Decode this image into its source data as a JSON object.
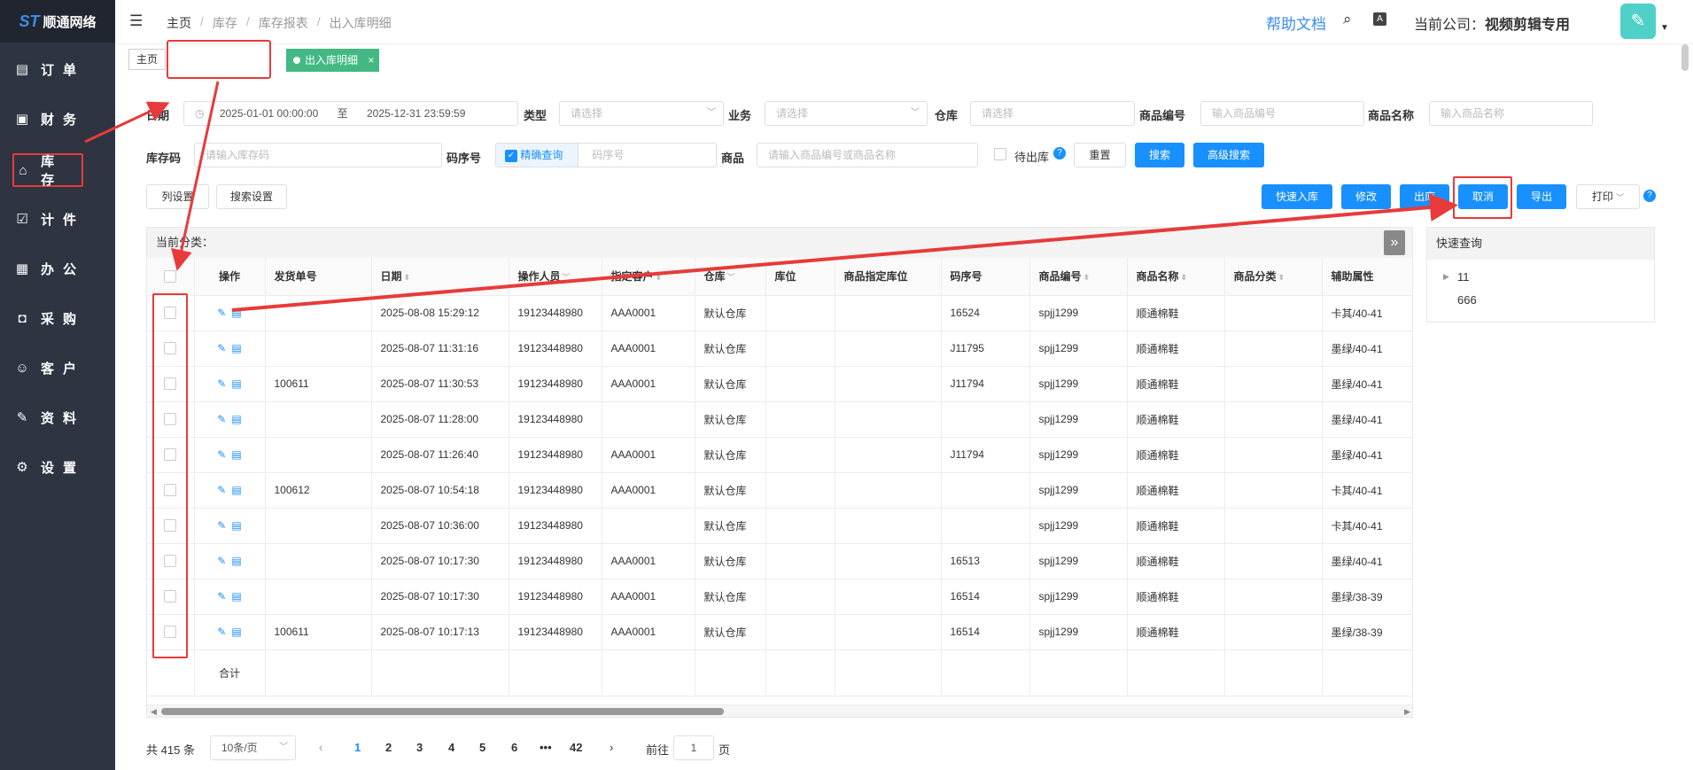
{
  "brand": {
    "name": "顺通网络"
  },
  "sidebar": {
    "items": [
      {
        "label": "订单",
        "icon": "order-icon"
      },
      {
        "label": "财务",
        "icon": "finance-icon"
      },
      {
        "label": "库存",
        "icon": "home-icon"
      },
      {
        "label": "计件",
        "icon": "clipboard-icon"
      },
      {
        "label": "办公",
        "icon": "calendar-icon"
      },
      {
        "label": "采购",
        "icon": "shopping-bag-icon"
      },
      {
        "label": "客户",
        "icon": "user-icon"
      },
      {
        "label": "资料",
        "icon": "pen-icon"
      },
      {
        "label": "设置",
        "icon": "gear-icon"
      }
    ],
    "active": "库存"
  },
  "header": {
    "breadcrumb": [
      "主页",
      "库存",
      "库存报表",
      "出入库明细"
    ],
    "help": "帮助文档",
    "company_label": "当前公司：",
    "company_name": "视频剪辑专用"
  },
  "tabs": {
    "home": "主页",
    "active": "出入库明细",
    "close": "×"
  },
  "filters": {
    "date_label": "日期",
    "date_from": "2025-01-01 00:00:00",
    "date_to_sep": "至",
    "date_to": "2025-12-31 23:59:59",
    "type_label": "类型",
    "type_placeholder": "请选择",
    "business_label": "业务",
    "business_placeholder": "请选择",
    "warehouse_label": "仓库",
    "warehouse_placeholder": "请选择",
    "sku_label": "商品编号",
    "sku_placeholder": "输入商品编号",
    "name_label": "商品名称",
    "name_placeholder": "输入商品名称",
    "stockcode_label": "库存码",
    "stockcode_placeholder": "请输入库存码",
    "serial_label": "码序号",
    "exact_label": "精确查询",
    "serial_placeholder": "码序号",
    "product_label": "商品",
    "product_placeholder": "请输入商品编号或商品名称",
    "pending_label": "待出库",
    "reset": "重置",
    "search": "搜索",
    "advanced": "高级搜索"
  },
  "toolbar": {
    "col_settings": "列设置",
    "search_settings": "搜索设置",
    "quick_in": "快速入库",
    "edit": "修改",
    "out": "出库",
    "cancel": "取消",
    "export": "导出",
    "print": "打印"
  },
  "table": {
    "category_label": "当前分类：",
    "columns": [
      "操作",
      "发货单号",
      "日期",
      "操作人员",
      "指定客户",
      "仓库",
      "库位",
      "商品指定库位",
      "码序号",
      "商品编号",
      "商品名称",
      "商品分类",
      "辅助属性"
    ],
    "rows": [
      {
        "ship": "",
        "date": "2025-08-08 15:29:12",
        "op": "19123448980",
        "cust": "AAA0001",
        "wh": "默认仓库",
        "loc": "",
        "ploc": "",
        "serial": "16524",
        "sku": "spjj1299",
        "name": "顺通棉鞋",
        "cat": "",
        "attr": "卡其/40-41"
      },
      {
        "ship": "",
        "date": "2025-08-07 11:31:16",
        "op": "19123448980",
        "cust": "AAA0001",
        "wh": "默认仓库",
        "loc": "",
        "ploc": "",
        "serial": "J11795",
        "sku": "spjj1299",
        "name": "顺通棉鞋",
        "cat": "",
        "attr": "墨绿/40-41"
      },
      {
        "ship": "100611",
        "date": "2025-08-07 11:30:53",
        "op": "19123448980",
        "cust": "AAA0001",
        "wh": "默认仓库",
        "loc": "",
        "ploc": "",
        "serial": "J11794",
        "sku": "spjj1299",
        "name": "顺通棉鞋",
        "cat": "",
        "attr": "墨绿/40-41"
      },
      {
        "ship": "",
        "date": "2025-08-07 11:28:00",
        "op": "19123448980",
        "cust": "",
        "wh": "默认仓库",
        "loc": "",
        "ploc": "",
        "serial": "",
        "sku": "spjj1299",
        "name": "顺通棉鞋",
        "cat": "",
        "attr": "墨绿/40-41"
      },
      {
        "ship": "",
        "date": "2025-08-07 11:26:40",
        "op": "19123448980",
        "cust": "AAA0001",
        "wh": "默认仓库",
        "loc": "",
        "ploc": "",
        "serial": "J11794",
        "sku": "spjj1299",
        "name": "顺通棉鞋",
        "cat": "",
        "attr": "墨绿/40-41"
      },
      {
        "ship": "100612",
        "date": "2025-08-07 10:54:18",
        "op": "19123448980",
        "cust": "AAA0001",
        "wh": "默认仓库",
        "loc": "",
        "ploc": "",
        "serial": "",
        "sku": "spjj1299",
        "name": "顺通棉鞋",
        "cat": "",
        "attr": "卡其/40-41"
      },
      {
        "ship": "",
        "date": "2025-08-07 10:36:00",
        "op": "19123448980",
        "cust": "",
        "wh": "默认仓库",
        "loc": "",
        "ploc": "",
        "serial": "",
        "sku": "spjj1299",
        "name": "顺通棉鞋",
        "cat": "",
        "attr": "卡其/40-41"
      },
      {
        "ship": "",
        "date": "2025-08-07 10:17:30",
        "op": "19123448980",
        "cust": "AAA0001",
        "wh": "默认仓库",
        "loc": "",
        "ploc": "",
        "serial": "16513",
        "sku": "spjj1299",
        "name": "顺通棉鞋",
        "cat": "",
        "attr": "墨绿/40-41"
      },
      {
        "ship": "",
        "date": "2025-08-07 10:17:30",
        "op": "19123448980",
        "cust": "AAA0001",
        "wh": "默认仓库",
        "loc": "",
        "ploc": "",
        "serial": "16514",
        "sku": "spjj1299",
        "name": "顺通棉鞋",
        "cat": "",
        "attr": "墨绿/38-39"
      },
      {
        "ship": "100611",
        "date": "2025-08-07 10:17:13",
        "op": "19123448980",
        "cust": "AAA0001",
        "wh": "默认仓库",
        "loc": "",
        "ploc": "",
        "serial": "16514",
        "sku": "spjj1299",
        "name": "顺通棉鞋",
        "cat": "",
        "attr": "墨绿/38-39"
      }
    ],
    "total_label": "合计"
  },
  "quick": {
    "title": "快速查询",
    "items": [
      "11",
      "666"
    ]
  },
  "pager": {
    "total": "共 415 条",
    "size": "10条/页",
    "pages": [
      "1",
      "2",
      "3",
      "4",
      "5",
      "6",
      "•••",
      "42"
    ],
    "goto": "前往",
    "goto_value": "1",
    "page_unit": "页"
  },
  "colors": {
    "accent": "#1890ff",
    "tab_active": "#42b983",
    "sidebar": "#2e3442",
    "annotation": "#e83a3a"
  }
}
